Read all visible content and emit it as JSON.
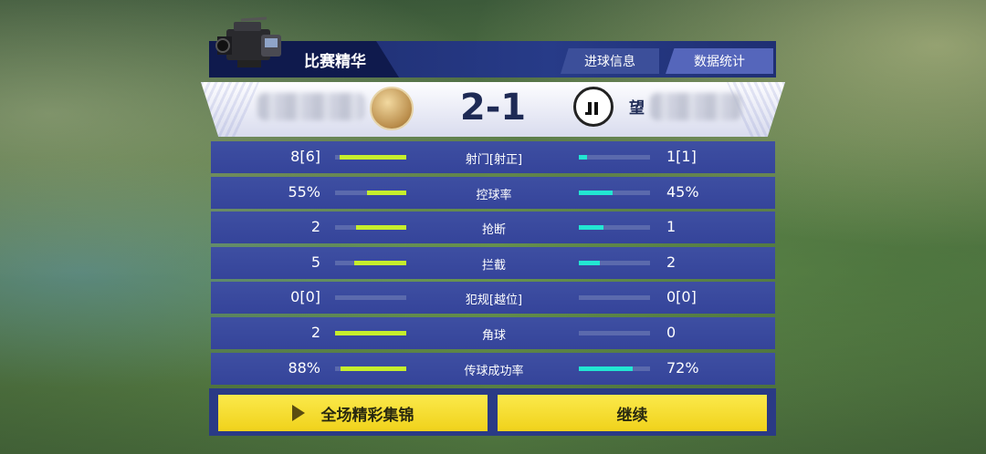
{
  "header": {
    "title": "比赛精华",
    "tabs": [
      {
        "label": "进球信息",
        "active": false
      },
      {
        "label": "数据统计",
        "active": true
      }
    ]
  },
  "score": {
    "text": "2-1",
    "home": {
      "name_blurred": true,
      "badge": "gold-team-badge"
    },
    "away": {
      "name_visible": "望",
      "name_blurred": true,
      "badge": "juventus-badge"
    }
  },
  "colors": {
    "home_bar": "#c6ee2c",
    "away_bar": "#22e6d2",
    "button": "#f4dc2a",
    "panel": "#35449a"
  },
  "stats": [
    {
      "label": "射门[射正]",
      "home": "8[6]",
      "away": "1[1]",
      "home_frac": 0.93,
      "away_frac": 0.12
    },
    {
      "label": "控球率",
      "home": "55%",
      "away": "45%",
      "home_frac": 0.55,
      "away_frac": 0.47
    },
    {
      "label": "抢断",
      "home": "2",
      "away": "1",
      "home_frac": 0.7,
      "away_frac": 0.35
    },
    {
      "label": "拦截",
      "home": "5",
      "away": "2",
      "home_frac": 0.73,
      "away_frac": 0.29
    },
    {
      "label": "犯规[越位]",
      "home": "0[0]",
      "away": "0[0]",
      "home_frac": 0,
      "away_frac": 0
    },
    {
      "label": "角球",
      "home": "2",
      "away": "0",
      "home_frac": 1.0,
      "away_frac": 0
    },
    {
      "label": "传球成功率",
      "home": "88%",
      "away": "72%",
      "home_frac": 0.92,
      "away_frac": 0.76
    }
  ],
  "buttons": {
    "highlights": "全场精彩集锦",
    "continue": "继续"
  }
}
